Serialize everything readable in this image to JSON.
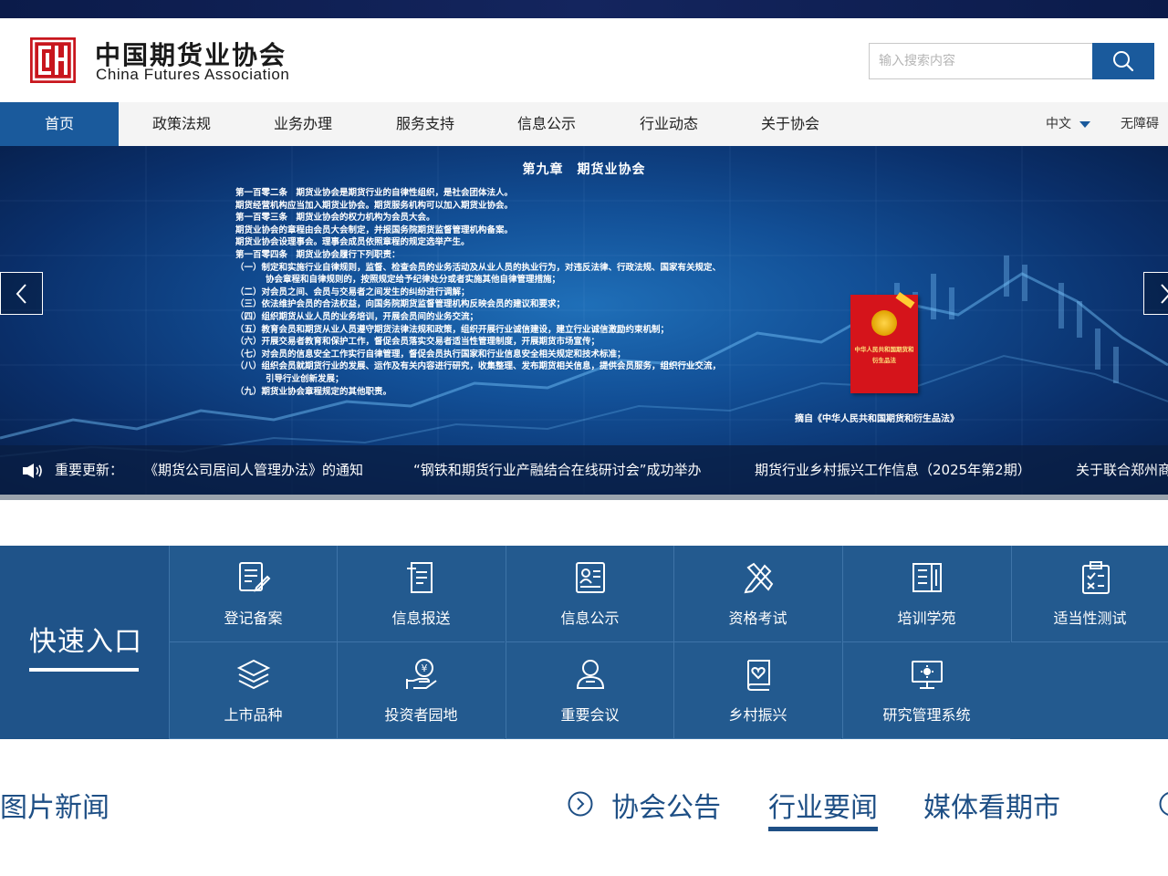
{
  "header": {
    "logo_cn": "中国期货业协会",
    "logo_en": "China Futures Association",
    "search_placeholder": "输入搜索内容"
  },
  "nav": {
    "items": [
      {
        "label": "首页",
        "active": true
      },
      {
        "label": "政策法规"
      },
      {
        "label": "业务办理"
      },
      {
        "label": "服务支持"
      },
      {
        "label": "信息公示"
      },
      {
        "label": "行业动态"
      },
      {
        "label": "关于协会"
      }
    ],
    "language": "中文",
    "accessibility": "无障碍"
  },
  "banner": {
    "title": "第九章　期货业协会",
    "lines": [
      "第一百零二条　期货业协会是期货行业的自律性组织，是社会团体法人。",
      "期货经营机构应当加入期货业协会。期货服务机构可以加入期货业协会。",
      "第一百零三条　期货业协会的权力机构为会员大会。",
      "期货业协会的章程由会员大会制定，并报国务院期货监督管理机构备案。",
      "期货业协会设理事会。理事会成员依照章程的规定选举产生。",
      "第一百零四条　期货业协会履行下列职责：",
      "（一）制定和实施行业自律规则，监督、检查会员的业务活动及从业人员的执业行为，对违反法律、行政法规、国家有关规定、",
      "协会章程和自律规则的，按照规定给予纪律处分或者实施其他自律管理措施；",
      "（二）对会员之间、会员与交易者之间发生的纠纷进行调解；",
      "（三）依法维护会员的合法权益，向国务院期货监督管理机构反映会员的建议和要求；",
      "（四）组织期货从业人员的业务培训，开展会员间的业务交流；",
      "（五）教育会员和期货从业人员遵守期货法律法规和政策，组织开展行业诚信建设，建立行业诚信激励约束机制；",
      "（六）开展交易者教育和保护工作，督促会员落实交易者适当性管理制度，开展期货市场宣传；",
      "（七）对会员的信息安全工作实行自律管理，督促会员执行国家和行业信息安全相关规定和技术标准；",
      "（八）组织会员就期货行业的发展、运作及有关内容进行研究，收集整理、发布期货相关信息，提供会员服务，组织行业交流，",
      "引导行业创新发展；",
      "（九）期货业协会章程规定的其他职责。"
    ],
    "book_text": "中华人民共和国期货和衍生品法",
    "caption": "摘自《中华人民共和国期货和衍生品法》"
  },
  "ticker": {
    "label": "重要更新：",
    "items": [
      "《期货公司居间人管理办法》的通知",
      "“钢铁和期货行业产融结合在线研讨会”成功举办",
      "期货行业乡村振兴工作信息（2025年第2期）",
      "关于联合郑州商"
    ]
  },
  "quick": {
    "title": "快速入口",
    "items": [
      {
        "label": "登记备案",
        "icon": "register-icon"
      },
      {
        "label": "信息报送",
        "icon": "report-icon"
      },
      {
        "label": "信息公示",
        "icon": "disclosure-icon"
      },
      {
        "label": "资格考试",
        "icon": "exam-icon"
      },
      {
        "label": "培训学苑",
        "icon": "training-icon"
      },
      {
        "label": "适当性测试",
        "icon": "checklist-icon"
      },
      {
        "label": "上市品种",
        "icon": "layers-icon"
      },
      {
        "label": "投资者园地",
        "icon": "investor-icon"
      },
      {
        "label": "重要会议",
        "icon": "meeting-icon"
      },
      {
        "label": "乡村振兴",
        "icon": "rural-icon"
      },
      {
        "label": "研究管理系统",
        "icon": "research-icon"
      }
    ]
  },
  "news": {
    "section_title": "图片新闻",
    "tabs": [
      {
        "label": "协会公告"
      },
      {
        "label": "行业要闻",
        "active": true
      },
      {
        "label": "媒体看期市"
      }
    ]
  },
  "colors": {
    "primary": "#1a5a9c",
    "quick_bg": "#235a8f",
    "logo_red": "#c8161d",
    "heading": "#1e4f85"
  }
}
